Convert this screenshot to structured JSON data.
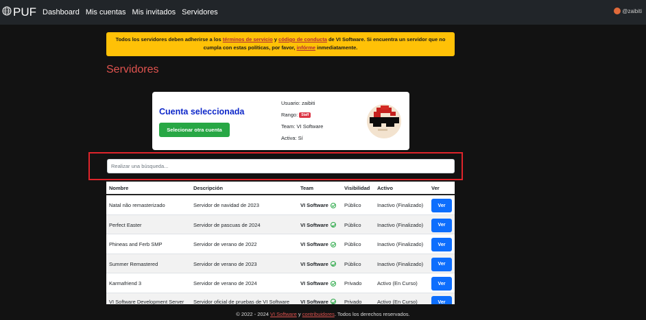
{
  "nav": {
    "brand": "PUF",
    "links": [
      "Dashboard",
      "Mis cuentas",
      "Mis invitados",
      "Servidores"
    ],
    "user": "@zaibiti"
  },
  "alert": {
    "p1": "Todos los servidores deben adherirse a los ",
    "link_terms": "términos de servicio",
    "p2": " y ",
    "link_conduct": "código de conducta",
    "p3": " de VI Software. Si encuentra un servidor que no cumpla con estas políticas, por favor, ",
    "link_report": "infórme",
    "p4": " inmediatamente."
  },
  "page_title": "Servidores",
  "account": {
    "title": "Cuenta seleccionada",
    "button": "Selecionar otra cuenta",
    "user_label": "Usuario:",
    "user_value": "zaibiti",
    "rank_label": "Rango:",
    "rank_value": "Staff",
    "team_label": "Team:",
    "team_value": "VI Software",
    "active_label": "Activa:",
    "active_value": "Sí"
  },
  "search": {
    "placeholder": "Realizar una búsqueda..."
  },
  "table": {
    "headers": [
      "Nombre",
      "Descripción",
      "Team",
      "Visibilidad",
      "Activo",
      "Ver"
    ],
    "rows": [
      {
        "name": "Natal não remasterizado",
        "desc": "Servidor de navidad de 2023",
        "team": "VI Software",
        "visibility": "Público",
        "active": "Inactivo (Finalizado)",
        "btn": "Ver"
      },
      {
        "name": "Perfect Easter",
        "desc": "Servidor de pascuas de 2024",
        "team": "VI Software",
        "visibility": "Público",
        "active": "Inactivo (Finalizado)",
        "btn": "Ver"
      },
      {
        "name": "Phineas and Ferb SMP",
        "desc": "Servidor de verano de 2022",
        "team": "VI Software",
        "visibility": "Público",
        "active": "Inactivo (Finalizado)",
        "btn": "Ver"
      },
      {
        "name": "Summer Remastered",
        "desc": "Servidor de verano de 2023",
        "team": "VI Software",
        "visibility": "Público",
        "active": "Inactivo (Finalizado)",
        "btn": "Ver"
      },
      {
        "name": "Karmafriend 3",
        "desc": "Servidor de verano de 2024",
        "team": "VI Software",
        "visibility": "Privado",
        "active": "Activo (En Curso)",
        "btn": "Ver"
      },
      {
        "name": "VI Software Development Server",
        "desc": "Servidor oficial de pruebas de VI Software",
        "team": "VI Software",
        "visibility": "Privado",
        "active": "Activo (En Curso)",
        "btn": "Ver"
      }
    ]
  },
  "footer": {
    "p1": "© 2022 - 2024 ",
    "link1": "VI Software",
    "p2": " y ",
    "link2": "contribuidores",
    "p3": ". Todos los derechos reservados."
  }
}
